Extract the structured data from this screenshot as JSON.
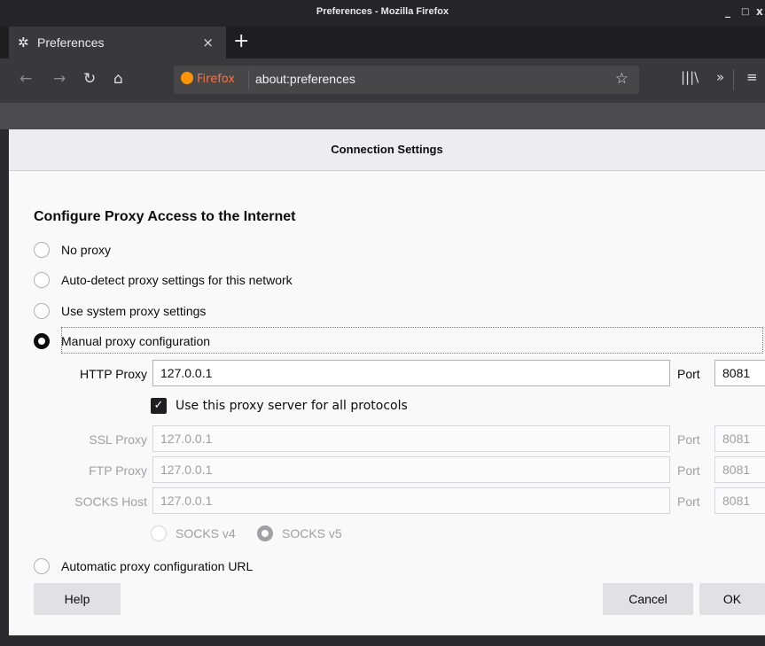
{
  "window": {
    "title": "Preferences - Mozilla Firefox",
    "controls": [
      "_",
      "□",
      "x"
    ]
  },
  "tab": {
    "label": "Preferences",
    "close": "×",
    "new_tab": "+"
  },
  "navbar": {
    "identity_label": "Firefox",
    "url": "about:preferences"
  },
  "dialog": {
    "title": "Connection Settings",
    "section_title": "Configure Proxy Access to the Internet",
    "options": {
      "no_proxy": "No proxy",
      "auto_detect": "Auto-detect proxy settings for this network",
      "system": "Use system proxy settings",
      "manual": "Manual proxy configuration",
      "auto_url": "Automatic proxy configuration URL"
    },
    "selected_option": "manual",
    "http_proxy": {
      "label": "HTTP Proxy",
      "value": "127.0.0.1",
      "port_label": "Port",
      "port": "8081"
    },
    "use_for_all": {
      "label": "Use this proxy server for all protocols",
      "checked": true
    },
    "ssl_proxy": {
      "label": "SSL Proxy",
      "value": "127.0.0.1",
      "port_label": "Port",
      "port": "8081"
    },
    "ftp_proxy": {
      "label": "FTP Proxy",
      "value": "127.0.0.1",
      "port_label": "Port",
      "port": "8081"
    },
    "socks_host": {
      "label": "SOCKS Host",
      "value": "127.0.0.1",
      "port_label": "Port",
      "port": "8081"
    },
    "socks_versions": {
      "v4": "SOCKS v4",
      "v5": "SOCKS v5",
      "selected": "v5"
    },
    "buttons": {
      "help": "Help",
      "cancel": "Cancel",
      "ok": "OK"
    }
  }
}
